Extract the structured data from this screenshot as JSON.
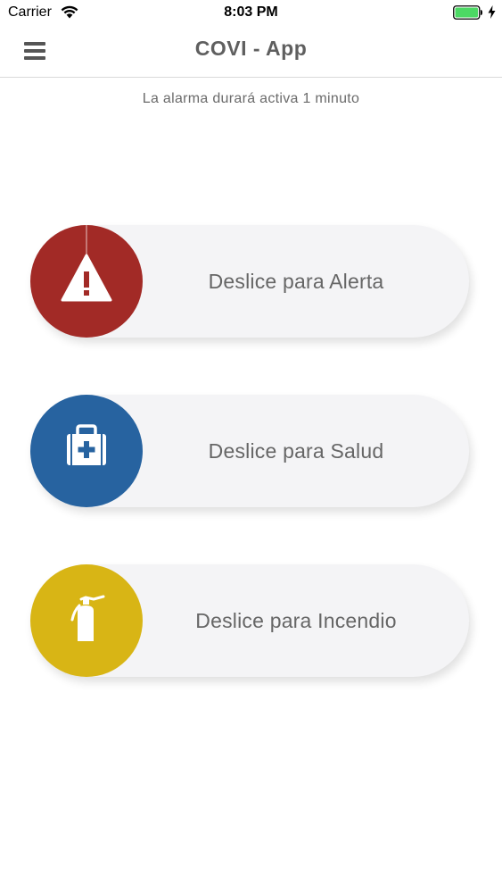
{
  "status_bar": {
    "carrier": "Carrier",
    "time": "8:03 PM"
  },
  "header": {
    "title": "COVI - App",
    "menu_icon": "hamburger-menu-icon"
  },
  "notice": "La alarma durará activa 1 minuto",
  "sliders": [
    {
      "label": "Deslice para Alerta",
      "icon": "warning-triangle-icon",
      "color": "#a22a26"
    },
    {
      "label": "Deslice para Salud",
      "icon": "first-aid-kit-icon",
      "color": "#2763a0"
    },
    {
      "label": "Deslice para Incendio",
      "icon": "fire-extinguisher-icon",
      "color": "#d8b515"
    }
  ],
  "colors": {
    "title_text": "#5f5f5f",
    "slider_track": "#f4f4f6",
    "battery": "#4cd964"
  }
}
